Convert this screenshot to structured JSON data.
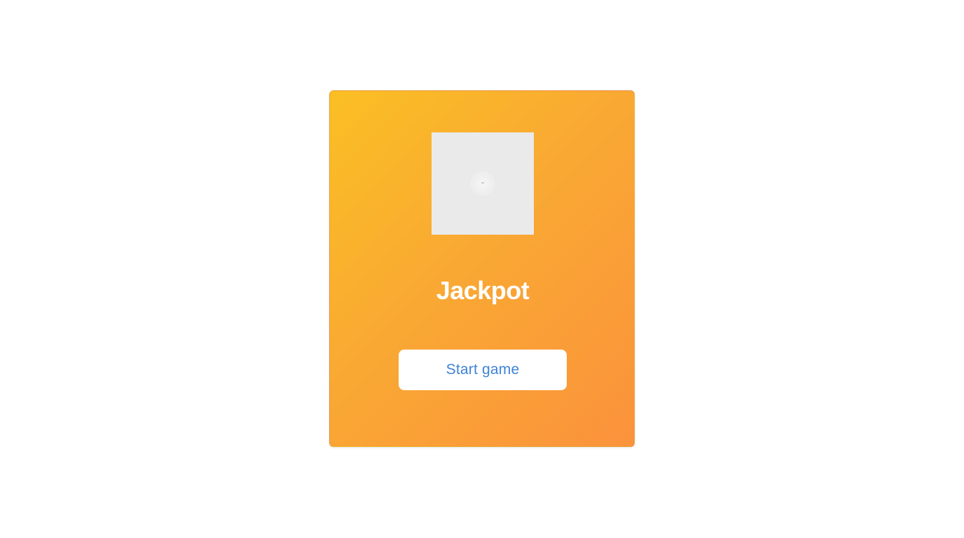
{
  "game": {
    "title": "Jackpot",
    "cover_image_icon": "loading-spinner-icon",
    "start_button_label": "Start game"
  },
  "colors": {
    "page_background": "#ffffff",
    "card_gradient_start": "#fbbf24",
    "card_gradient_end": "#fb923c",
    "title_text": "#ffffff",
    "button_background": "#ffffff",
    "button_text": "#3f82d9",
    "image_placeholder": "#eaeaea"
  }
}
